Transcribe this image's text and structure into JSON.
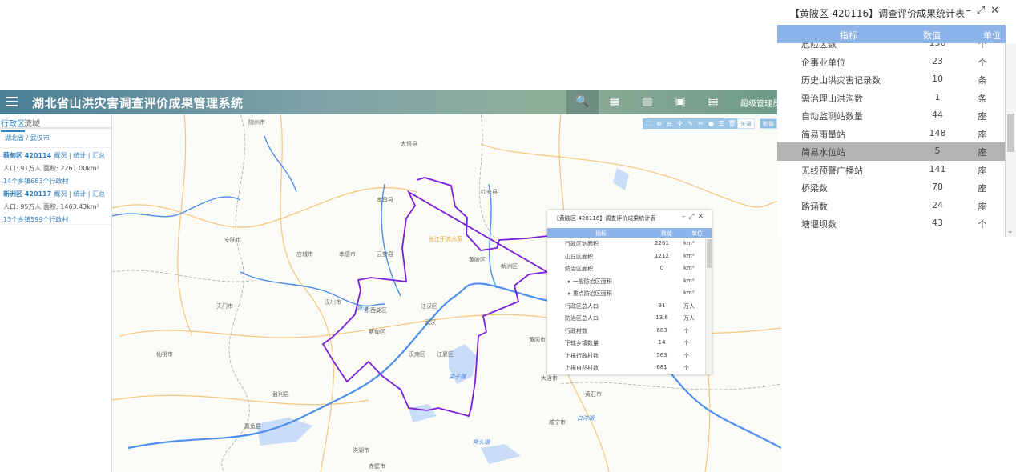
{
  "header": {
    "title": "湖北省山洪灾害调查评价成果管理系统",
    "user": "超级管理员",
    "toolbar": [
      {
        "icon": "search-icon",
        "glyph": "🔍"
      },
      {
        "icon": "table-icon",
        "glyph": "▦"
      },
      {
        "icon": "map-icon",
        "glyph": "▥"
      },
      {
        "icon": "image-icon",
        "glyph": "▣"
      },
      {
        "icon": "document-icon",
        "glyph": "▤"
      }
    ]
  },
  "sidebar": {
    "tabs": [
      "行政区",
      "流域"
    ],
    "breadcrumb": "湖北省 / 武汉市",
    "items": [
      {
        "name": "蔡甸区 420114",
        "links": "概况 | 统计 | 汇总",
        "info": "人口: 91万人 面积: 2261.00km²",
        "villages": "14个乡镇683个行政村"
      },
      {
        "name": "新洲区 420117",
        "links": "概况 | 统计 | 汇总",
        "info": "人口: 95万人 面积: 1463.43km²",
        "villages": "13个乡镇599个行政村"
      }
    ]
  },
  "map": {
    "controls": [
      "⛶",
      "⊕",
      "⊖",
      "✛",
      "✎",
      "✂",
      "●",
      "☰",
      "🗑"
    ],
    "layer_buttons": [
      "矢量",
      "影像"
    ],
    "active_layer": "影像",
    "labels": [
      "随州市",
      "大悟县",
      "孝昌县",
      "红安县",
      "安陆市",
      "应城市",
      "孝感市",
      "云梦县",
      "汉川市",
      "天门市",
      "仙桃市",
      "府河",
      "长江干流水系",
      "新洲区",
      "黄陂区",
      "东西湖区",
      "江汉区",
      "武汉",
      "蔡甸区",
      "汉南区",
      "江夏区",
      "梁子湖",
      "团风县",
      "黄冈市",
      "鄂州市",
      "咸宁市",
      "嘉鱼县",
      "洪湖市",
      "赤壁市",
      "斧头湖",
      "大冶市",
      "黄石市",
      "阳新县",
      "浠水县",
      "白洋湖",
      "监利县"
    ],
    "boundary_color": "#7a1fd8",
    "water_color": "#4d8fea",
    "road_color": "#f5c67a"
  },
  "popup_small": {
    "title": "【黄陂区-420116】调查评价成果统计表",
    "headers": [
      "指标",
      "数值",
      "单位"
    ],
    "rows": [
      [
        "行政区划面积",
        "2261",
        "km²"
      ],
      [
        "山丘区面积",
        "1212",
        "km²"
      ],
      [
        "防治区面积",
        "0",
        "km²"
      ],
      [
        "▸ 一般防治区面积",
        "",
        "km²"
      ],
      [
        "▸ 重点防治区面积",
        "",
        "km²"
      ],
      [
        "行政区总人口",
        "91",
        "万人"
      ],
      [
        "防治区总人口",
        "13.6",
        "万人"
      ],
      [
        "行政村数",
        "683",
        "个"
      ],
      [
        "下辖乡镇数量",
        "14",
        "个"
      ],
      [
        "上报行政村数",
        "563",
        "个"
      ],
      [
        "上报自然村数",
        "681",
        "个"
      ]
    ]
  },
  "stats_panel": {
    "title": "【黄陂区-420116】调查评价成果统计表",
    "headers": [
      "指标",
      "数值",
      "单位"
    ],
    "highlight_color": "#b3b3b3",
    "header_color": "#8db4ea",
    "rows": [
      [
        "危险区数",
        "156",
        "个"
      ],
      [
        "企事业单位",
        "23",
        "个"
      ],
      [
        "历史山洪灾害记录数",
        "10",
        "条"
      ],
      [
        "需治理山洪沟数",
        "1",
        "条"
      ],
      [
        "自动监测站数量",
        "44",
        "座"
      ],
      [
        "简易雨量站",
        "148",
        "座"
      ],
      [
        "简易水位站",
        "5",
        "座"
      ],
      [
        "无线预警广播站",
        "141",
        "座"
      ],
      [
        "桥梁数",
        "78",
        "座"
      ],
      [
        "路涵数",
        "24",
        "座"
      ],
      [
        "塘堰坝数",
        "43",
        "个"
      ]
    ],
    "selected_row": "简易水位站"
  }
}
